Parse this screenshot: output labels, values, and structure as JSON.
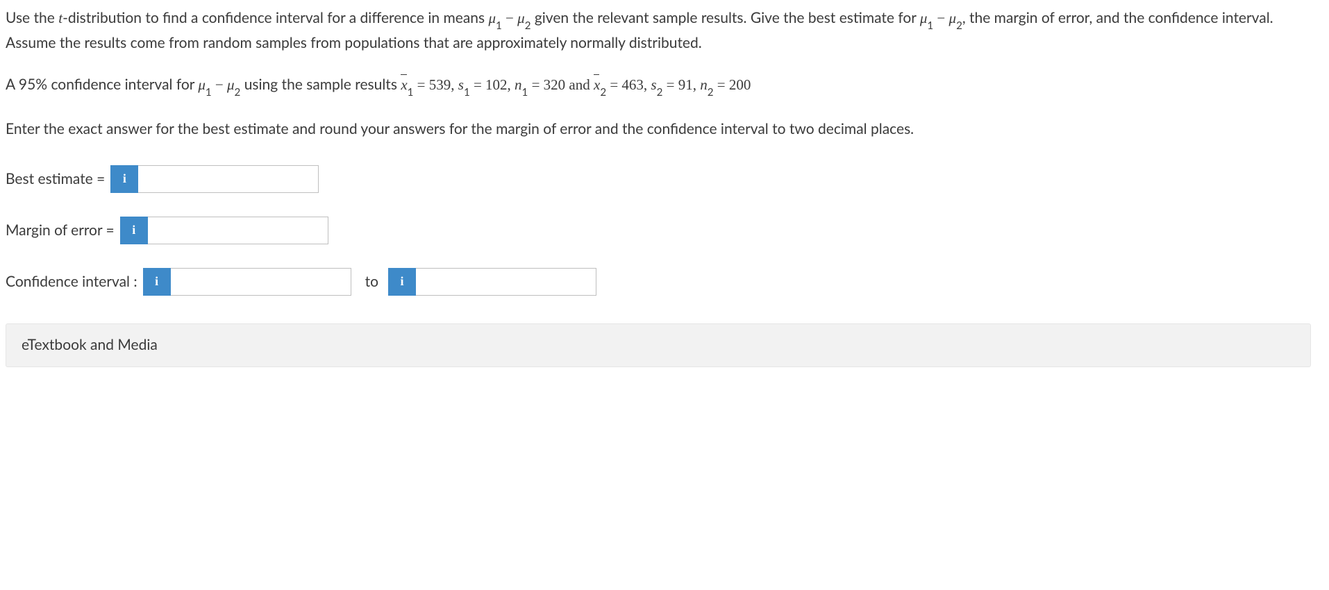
{
  "question": {
    "intro_part1": "Use the ",
    "intro_t": "t",
    "intro_part2": "-distribution to find a confidence interval for a difference in means ",
    "mu1": "μ",
    "sub1": "1",
    "minus": " − ",
    "mu2": "μ",
    "sub2": "2",
    "intro_part3": " given the relevant sample results. Give the best estimate for ",
    "intro_part4": ", the margin of error, and the confidence interval. Assume the results come from random samples from populations that are approximately normally distributed."
  },
  "params": {
    "lead": "A 95% confidence interval for ",
    "mu1": "μ",
    "sub1": "1",
    "minus": " − ",
    "mu2": "μ",
    "sub2": "2",
    "mid": " using the sample results ",
    "xbar1": "x",
    "xbar1_sub": "1",
    "eq1": " = 539, ",
    "s1": "s",
    "s1_sub": "1",
    "eq2": " = 102, ",
    "n1": "n",
    "n1_sub": "1",
    "eq3": " = 320 and ",
    "xbar2": "x",
    "xbar2_sub": "2",
    "eq4": " = 463, ",
    "s2": "s",
    "s2_sub": "2",
    "eq5": " = 91, ",
    "n2": "n",
    "n2_sub": "2",
    "eq6": " = 200"
  },
  "instructions": "Enter the exact answer for the best estimate and round your answers for the margin of error and the confidence interval to two decimal places.",
  "answers": {
    "best_estimate_label": "Best estimate = ",
    "margin_label": "Margin of error = ",
    "ci_label": "Confidence interval : ",
    "to_label": "to",
    "info_icon": "i",
    "best_estimate_value": "",
    "margin_value": "",
    "ci_lower": "",
    "ci_upper": ""
  },
  "footer": {
    "etextbook_label": "eTextbook and Media"
  }
}
